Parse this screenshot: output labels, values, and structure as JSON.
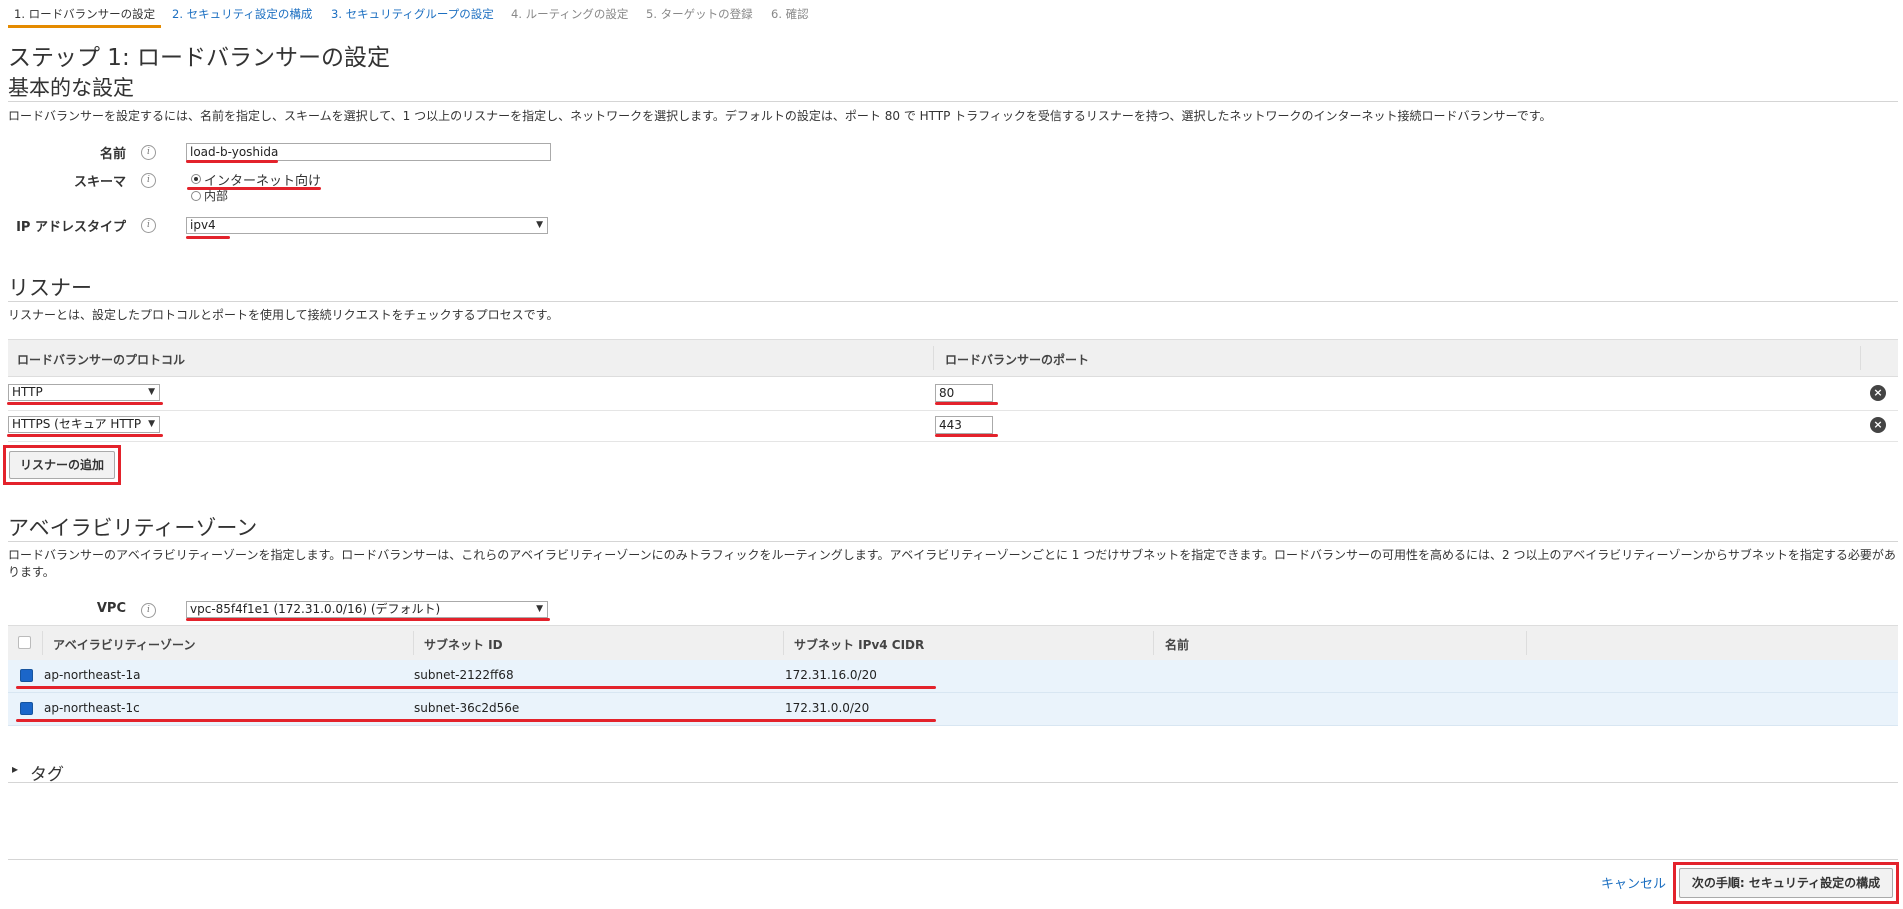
{
  "wizard": {
    "steps": [
      {
        "label": "1. ロードバランサーの設定",
        "state": "active"
      },
      {
        "label": "2. セキュリティ設定の構成",
        "state": "link"
      },
      {
        "label": "3. セキュリティグループの設定",
        "state": "link"
      },
      {
        "label": "4. ルーティングの設定",
        "state": "disabled"
      },
      {
        "label": "5. ターゲットの登録",
        "state": "disabled"
      },
      {
        "label": "6. 確認",
        "state": "disabled"
      }
    ]
  },
  "page_title": "ステップ 1: ロードバランサーの設定",
  "basic": {
    "title": "基本的な設定",
    "description": "ロードバランサーを設定するには、名前を指定し、スキームを選択して、1 つ以上のリスナーを指定し、ネットワークを選択します。デフォルトの設定は、ポート 80 で HTTP トラフィックを受信するリスナーを持つ、選択したネットワークのインターネット接続ロードバランサーです。",
    "name_label": "名前",
    "name_value": "load-b-yoshida",
    "scheme_label": "スキーマ",
    "scheme_options": [
      "インターネット向け",
      "内部"
    ],
    "ip_label": "IP アドレスタイプ",
    "ip_value": "ipv4",
    "info_glyph": "i"
  },
  "listener": {
    "title": "リスナー",
    "description": "リスナーとは、設定したプロトコルとポートを使用して接続リクエストをチェックするプロセスです。",
    "col_protocol": "ロードバランサーのプロトコル",
    "col_port": "ロードバランサーのポート",
    "rows": [
      {
        "protocol": "HTTP",
        "port": "80"
      },
      {
        "protocol": "HTTPS (セキュア HTTP",
        "port": "443"
      }
    ],
    "add_button": "リスナーの追加",
    "remove_glyph": "×",
    "arrow_glyph": "▼"
  },
  "az": {
    "title": "アベイラビリティーゾーン",
    "description": "ロードバランサーのアベイラビリティーゾーンを指定します。ロードバランサーは、これらのアベイラビリティーゾーンにのみトラフィックをルーティングします。アベイラビリティーゾーンごとに 1 つだけサブネットを指定できます。ロードバランサーの可用性を高めるには、2 つ以上のアベイラビリティーゾーンからサブネットを指定する必要があります。",
    "vpc_label": "VPC",
    "vpc_value": "vpc-85f4f1e1 (172.31.0.0/16) (デフォルト)",
    "columns": [
      "アベイラビリティーゾーン",
      "サブネット ID",
      "サブネット IPv4 CIDR",
      "名前"
    ],
    "rows": [
      {
        "zone": "ap-northeast-1a",
        "subnet": "subnet-2122ff68",
        "cidr": "172.31.16.0/20",
        "name": ""
      },
      {
        "zone": "ap-northeast-1c",
        "subnet": "subnet-36c2d56e",
        "cidr": "172.31.0.0/20",
        "name": ""
      }
    ]
  },
  "tags": {
    "label": "タグ",
    "toggle_glyph": "▸"
  },
  "footer": {
    "cancel": "キャンセル",
    "next": "次の手順: セキュリティ設定の構成"
  },
  "colors": {
    "accent_tab": "#e58b00",
    "link": "#1c6fc1",
    "annotation_red": "#e3222b",
    "checkbox_blue": "#1b66c9"
  }
}
